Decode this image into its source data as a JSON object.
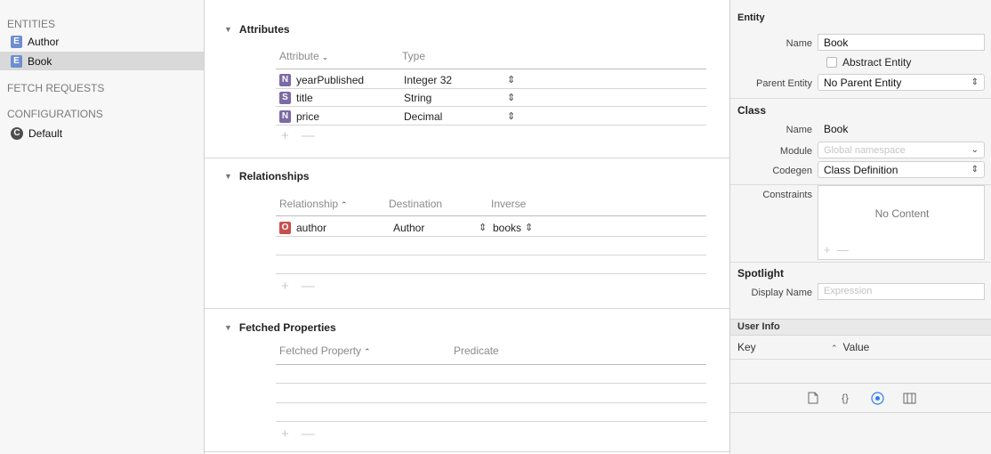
{
  "sidebar": {
    "entities_title": "ENTITIES",
    "entities": [
      {
        "badge": "E",
        "label": "Author",
        "selected": false
      },
      {
        "badge": "E",
        "label": "Book",
        "selected": true
      }
    ],
    "fetch_requests_title": "FETCH REQUESTS",
    "configurations_title": "CONFIGURATIONS",
    "configurations": [
      {
        "badge": "C",
        "label": "Default"
      }
    ]
  },
  "attributes": {
    "title": "Attributes",
    "col_attribute": "Attribute",
    "col_type": "Type",
    "rows": [
      {
        "badge": "N",
        "name": "yearPublished",
        "type": "Integer 32"
      },
      {
        "badge": "S",
        "name": "title",
        "type": "String"
      },
      {
        "badge": "N",
        "name": "price",
        "type": "Decimal"
      }
    ],
    "add": "+",
    "remove": "—"
  },
  "relationships": {
    "title": "Relationships",
    "col_relationship": "Relationship",
    "col_destination": "Destination",
    "col_inverse": "Inverse",
    "rows": [
      {
        "badge": "O",
        "name": "author",
        "destination": "Author",
        "inverse": "books"
      }
    ],
    "add": "+",
    "remove": "—"
  },
  "fetched_properties": {
    "title": "Fetched Properties",
    "col_property": "Fetched Property",
    "col_predicate": "Predicate",
    "add": "+",
    "remove": "—"
  },
  "inspector": {
    "entity_heading": "Entity",
    "name_label": "Name",
    "name_value": "Book",
    "abstract_label": "Abstract Entity",
    "parent_label": "Parent Entity",
    "parent_value": "No Parent Entity",
    "class_heading": "Class",
    "class_name_label": "Name",
    "class_name_value": "Book",
    "module_label": "Module",
    "module_placeholder": "Global namespace",
    "codegen_label": "Codegen",
    "codegen_value": "Class Definition",
    "constraints_label": "Constraints",
    "no_content": "No Content",
    "spotlight_heading": "Spotlight",
    "display_name_label": "Display Name",
    "display_name_placeholder": "Expression",
    "user_info_heading": "User Info",
    "key_col": "Key",
    "value_col": "Value"
  }
}
